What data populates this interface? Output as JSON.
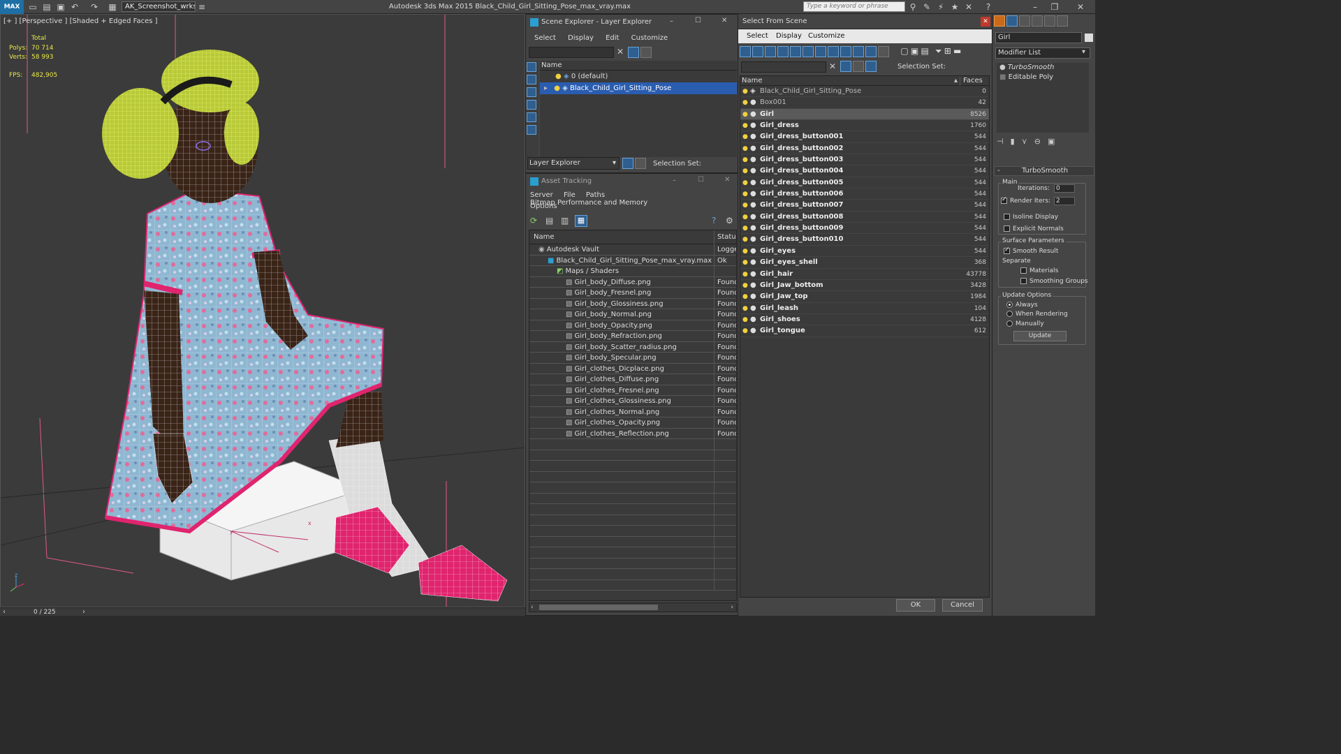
{
  "titlebar": {
    "logo": "MAX",
    "workspace": "AK_Screenshot_wrksp",
    "app_title": "Autodesk 3ds Max  2015     Black_Child_Girl_Sitting_Pose_max_vray.max",
    "search_placeholder": "Type a keyword or phrase"
  },
  "viewport": {
    "label": "[+ ] [Perspective ] [Shaded + Edged Faces ]",
    "stats": {
      "total_label": "Total",
      "polys_label": "Polys:",
      "polys_value": "70 714",
      "verts_label": "Verts:",
      "verts_value": "58 993",
      "fps_label": "FPS:",
      "fps_value": "482,905"
    },
    "axis_x": "x",
    "axis_y": "y",
    "axis_z": "z",
    "timeline": "0 / 225"
  },
  "scene_explorer": {
    "title": "Scene Explorer - Layer Explorer",
    "menu": [
      "Select",
      "Display",
      "Edit",
      "Customize"
    ],
    "col_name": "Name",
    "layers": [
      {
        "label": "0 (default)",
        "selected": false
      },
      {
        "label": "Black_Child_Girl_Sitting_Pose",
        "selected": true
      }
    ],
    "footer_dropdown": "Layer Explorer",
    "selection_set": "Selection Set:"
  },
  "asset_tracking": {
    "title": "Asset Tracking",
    "menu": [
      "Server",
      "File",
      "Paths",
      "Bitmap Performance and Memory"
    ],
    "menu2": "Options",
    "col_name": "Name",
    "col_status": "Status",
    "rows": [
      {
        "name": "Autodesk Vault",
        "status": "Logged",
        "indent": 1
      },
      {
        "name": "Black_Child_Girl_Sitting_Pose_max_vray.max",
        "status": "Ok",
        "indent": 2
      },
      {
        "name": "Maps / Shaders",
        "status": "",
        "indent": 3
      },
      {
        "name": "Girl_body_Diffuse.png",
        "status": "Found",
        "indent": 4
      },
      {
        "name": "Girl_body_Fresnel.png",
        "status": "Found",
        "indent": 4
      },
      {
        "name": "Girl_body_Glossiness.png",
        "status": "Found",
        "indent": 4
      },
      {
        "name": "Girl_body_Normal.png",
        "status": "Found",
        "indent": 4
      },
      {
        "name": "Girl_body_Opacity.png",
        "status": "Found",
        "indent": 4
      },
      {
        "name": "Girl_body_Refraction.png",
        "status": "Found",
        "indent": 4
      },
      {
        "name": "Girl_body_Scatter_radius.png",
        "status": "Found",
        "indent": 4
      },
      {
        "name": "Girl_body_Specular.png",
        "status": "Found",
        "indent": 4
      },
      {
        "name": "Girl_clothes_Dicplace.png",
        "status": "Found",
        "indent": 4
      },
      {
        "name": "Girl_clothes_Diffuse.png",
        "status": "Found",
        "indent": 4
      },
      {
        "name": "Girl_clothes_Fresnel.png",
        "status": "Found",
        "indent": 4
      },
      {
        "name": "Girl_clothes_Glossiness.png",
        "status": "Found",
        "indent": 4
      },
      {
        "name": "Girl_clothes_Normal.png",
        "status": "Found",
        "indent": 4
      },
      {
        "name": "Girl_clothes_Opacity.png",
        "status": "Found",
        "indent": 4
      },
      {
        "name": "Girl_clothes_Reflection.png",
        "status": "Found",
        "indent": 4
      }
    ]
  },
  "select_from_scene": {
    "title": "Select From Scene",
    "menu": [
      "Select",
      "Display",
      "Customize"
    ],
    "selection_set": "Selection Set:",
    "col_name": "Name",
    "col_faces": "Faces",
    "rows": [
      {
        "name": "Black_Child_Girl_Sitting_Pose",
        "faces": "0",
        "bold": false,
        "selected": false
      },
      {
        "name": "Box001",
        "faces": "42",
        "bold": false,
        "selected": false
      },
      {
        "name": "Girl",
        "faces": "8526",
        "bold": true,
        "selected": true
      },
      {
        "name": "Girl_dress",
        "faces": "1760",
        "bold": true,
        "selected": false
      },
      {
        "name": "Girl_dress_button001",
        "faces": "544",
        "bold": true,
        "selected": false
      },
      {
        "name": "Girl_dress_button002",
        "faces": "544",
        "bold": true,
        "selected": false
      },
      {
        "name": "Girl_dress_button003",
        "faces": "544",
        "bold": true,
        "selected": false
      },
      {
        "name": "Girl_dress_button004",
        "faces": "544",
        "bold": true,
        "selected": false
      },
      {
        "name": "Girl_dress_button005",
        "faces": "544",
        "bold": true,
        "selected": false
      },
      {
        "name": "Girl_dress_button006",
        "faces": "544",
        "bold": true,
        "selected": false
      },
      {
        "name": "Girl_dress_button007",
        "faces": "544",
        "bold": true,
        "selected": false
      },
      {
        "name": "Girl_dress_button008",
        "faces": "544",
        "bold": true,
        "selected": false
      },
      {
        "name": "Girl_dress_button009",
        "faces": "544",
        "bold": true,
        "selected": false
      },
      {
        "name": "Girl_dress_button010",
        "faces": "544",
        "bold": true,
        "selected": false
      },
      {
        "name": "Girl_eyes",
        "faces": "544",
        "bold": true,
        "selected": false
      },
      {
        "name": "Girl_eyes_shell",
        "faces": "368",
        "bold": true,
        "selected": false
      },
      {
        "name": "Girl_hair",
        "faces": "43778",
        "bold": true,
        "selected": false
      },
      {
        "name": "Girl_Jaw_bottom",
        "faces": "3428",
        "bold": true,
        "selected": false
      },
      {
        "name": "Girl_Jaw_top",
        "faces": "1984",
        "bold": true,
        "selected": false
      },
      {
        "name": "Girl_leash",
        "faces": "104",
        "bold": true,
        "selected": false
      },
      {
        "name": "Girl_shoes",
        "faces": "4128",
        "bold": true,
        "selected": false
      },
      {
        "name": "Girl_tongue",
        "faces": "612",
        "bold": true,
        "selected": false
      }
    ],
    "ok": "OK",
    "cancel": "Cancel"
  },
  "command_panel": {
    "object_name": "Girl",
    "modifier_list": "Modifier List",
    "stack": [
      "TurboSmooth",
      "Editable Poly"
    ],
    "rollout_title": "TurboSmooth",
    "main_label": "Main",
    "iterations_label": "Iterations:",
    "iterations_value": "0",
    "render_iters_label": "Render Iters:",
    "render_iters_value": "2",
    "isoline_label": "Isoline Display",
    "explicit_normals_label": "Explicit Normals",
    "surface_params_label": "Surface Parameters",
    "smooth_result_label": "Smooth Result",
    "separate_label": "Separate",
    "materials_label": "Materials",
    "smoothing_groups_label": "Smoothing Groups",
    "update_options_label": "Update Options",
    "always_label": "Always",
    "when_rendering_label": "When Rendering",
    "manually_label": "Manually",
    "update_button": "Update"
  },
  "colors": {
    "selection_blue": "#2a5db0",
    "hair_yellow": "#d6e84a",
    "dress_pink": "#e0246e",
    "stats_yellow": "#e8e84a"
  }
}
